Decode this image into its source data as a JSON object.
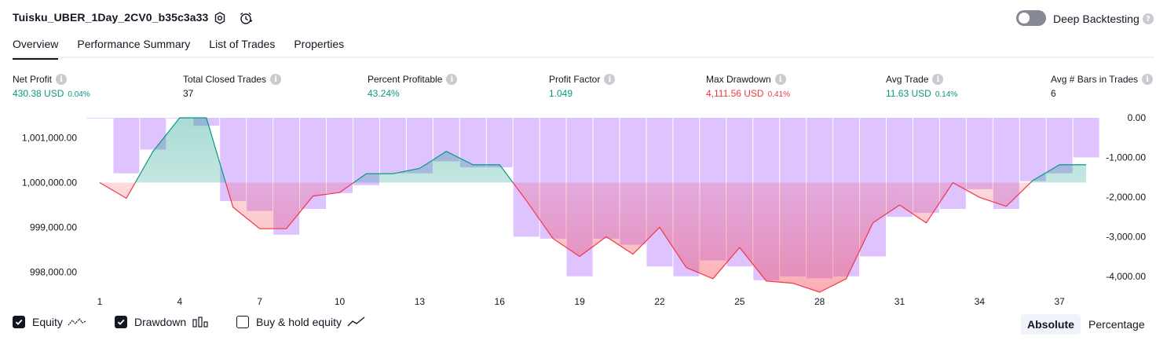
{
  "header": {
    "title": "Tuisku_UBER_1Day_2CV0_b35c3a33",
    "deep_backtesting_label": "Deep Backtesting",
    "deep_backtesting_on": false
  },
  "tabs": [
    {
      "label": "Overview",
      "active": true
    },
    {
      "label": "Performance Summary",
      "active": false
    },
    {
      "label": "List of Trades",
      "active": false
    },
    {
      "label": "Properties",
      "active": false
    }
  ],
  "stats": [
    {
      "label": "Net Profit",
      "value": "430.38 USD",
      "pct": "0.04%",
      "tone": "pos"
    },
    {
      "label": "Total Closed Trades",
      "value": "37",
      "pct": "",
      "tone": ""
    },
    {
      "label": "Percent Profitable",
      "value": "43.24%",
      "pct": "",
      "tone": "pos"
    },
    {
      "label": "Profit Factor",
      "value": "1.049",
      "pct": "",
      "tone": "pos"
    },
    {
      "label": "Max Drawdown",
      "value": "4,111.56 USD",
      "pct": "0.41%",
      "tone": "neg"
    },
    {
      "label": "Avg Trade",
      "value": "11.63 USD",
      "pct": "0.14%",
      "tone": "pos"
    },
    {
      "label": "Avg # Bars in Trades",
      "value": "6",
      "pct": "",
      "tone": ""
    }
  ],
  "legend": {
    "equity": {
      "label": "Equity",
      "checked": true
    },
    "drawdown": {
      "label": "Drawdown",
      "checked": true
    },
    "buy_hold": {
      "label": "Buy & hold equity",
      "checked": false
    }
  },
  "modes": {
    "absolute": "Absolute",
    "percentage": "Percentage",
    "selected": "absolute"
  },
  "colors": {
    "profit": "#089981",
    "loss": "#f23645",
    "drawdown_bar": "#d9b8ff",
    "text": "#131722"
  },
  "chart_data": {
    "type": "line",
    "x_ticks": [
      "1",
      "4",
      "7",
      "10",
      "13",
      "16",
      "19",
      "22",
      "25",
      "28",
      "31",
      "34",
      "37"
    ],
    "left_axis": {
      "ticks": [
        "1,001,000.00",
        "1,000,000.00",
        "999,000.00",
        "998,000.00"
      ],
      "ylim": [
        997550,
        1001450
      ]
    },
    "right_axis": {
      "ticks": [
        "0.00",
        "-1,000.00",
        "-2,000.00",
        "-3,000.00",
        "-4,000.00"
      ],
      "ylim": [
        -4400,
        0
      ]
    },
    "series": [
      {
        "name": "Equity",
        "x": [
          1,
          2,
          3,
          4,
          5,
          6,
          7,
          8,
          9,
          10,
          11,
          12,
          13,
          14,
          15,
          16,
          17,
          18,
          19,
          20,
          21,
          22,
          23,
          24,
          25,
          26,
          27,
          28,
          29,
          30,
          31,
          32,
          33,
          34,
          35,
          36,
          37,
          38
        ],
        "values": [
          1000000,
          999650,
          1000700,
          1001450,
          1001450,
          999450,
          998970,
          998970,
          999700,
          999780,
          1000200,
          1000200,
          1000320,
          1000700,
          1000400,
          1000400,
          999600,
          998750,
          998350,
          998790,
          998400,
          999000,
          998100,
          997850,
          998550,
          997800,
          997750,
          997550,
          997850,
          999100,
          999500,
          999100,
          1000000,
          999670,
          999470,
          1000050,
          1000400,
          1000400
        ]
      },
      {
        "name": "Drawdown",
        "x": [
          1,
          2,
          3,
          4,
          5,
          6,
          7,
          8,
          9,
          10,
          11,
          12,
          13,
          14,
          15,
          16,
          17,
          18,
          19,
          20,
          21,
          22,
          23,
          24,
          25,
          26,
          27,
          28,
          29,
          30,
          31,
          32,
          33,
          34,
          35,
          36,
          37,
          38
        ],
        "values": [
          0,
          -1400,
          -800,
          0,
          -200,
          -2100,
          -2350,
          -2950,
          -2300,
          -1900,
          -1700,
          -1400,
          -1400,
          -1100,
          -1250,
          -1250,
          -3000,
          -3050,
          -4000,
          -3050,
          -3200,
          -3750,
          -4000,
          -3600,
          -3750,
          -4100,
          -4000,
          -4050,
          -4000,
          -3500,
          -2500,
          -2400,
          -2300,
          -1800,
          -2300,
          -1600,
          -1400,
          -1000
        ]
      }
    ]
  }
}
